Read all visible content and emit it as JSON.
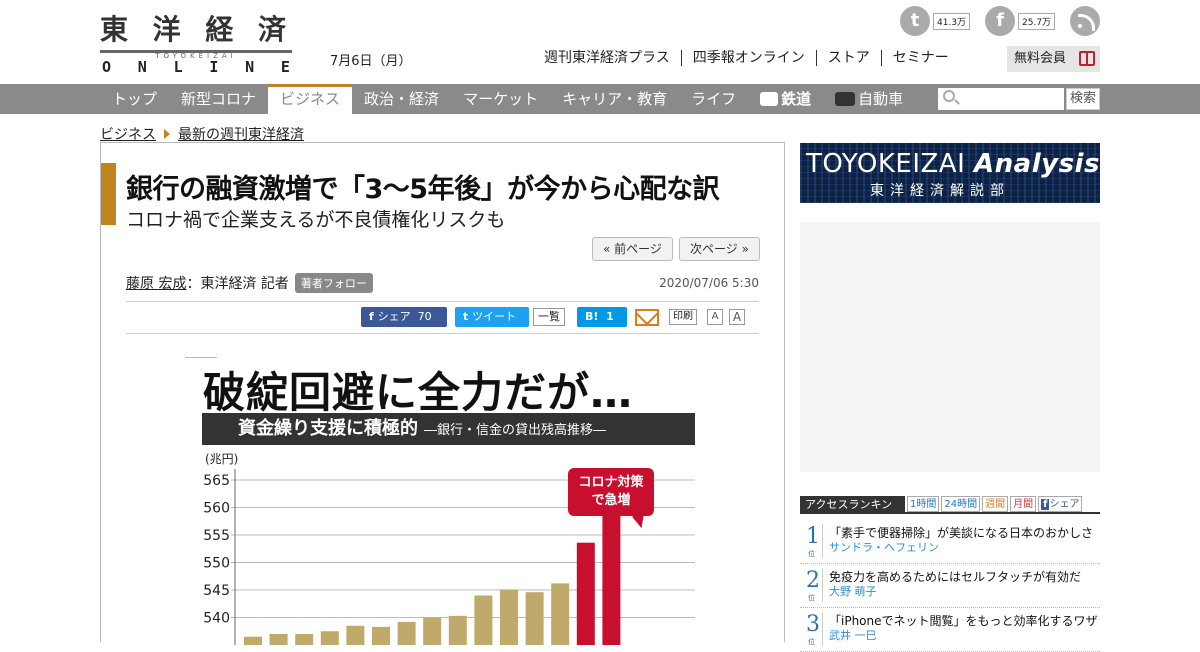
{
  "header": {
    "logo": {
      "main_chars": [
        "東",
        "洋",
        "経",
        "済"
      ],
      "sub": "TOYOKEIZAI",
      "online_chars": [
        "O",
        "N",
        "L",
        "I",
        "N",
        "E"
      ]
    },
    "date": "7月6日（月）",
    "top_links": [
      "週刊東洋経済プラス",
      "四季報オンライン",
      "ストア",
      "セミナー"
    ],
    "member_label": "無料会員",
    "twitter_count": "41.3万",
    "facebook_count": "25.7万"
  },
  "nav": {
    "items": [
      {
        "label": "トップ",
        "active": false
      },
      {
        "label": "新型コロナ",
        "active": false
      },
      {
        "label": "ビジネス",
        "active": true
      },
      {
        "label": "政治・経済",
        "active": false
      },
      {
        "label": "マーケット",
        "active": false
      },
      {
        "label": "キャリア・教育",
        "active": false
      },
      {
        "label": "ライフ",
        "active": false
      }
    ],
    "railway": "鉄道",
    "car": "自動車",
    "search_button": "検索"
  },
  "breadcrumb": {
    "section": "ビジネス",
    "sub": "最新の週刊東洋経済"
  },
  "article": {
    "title": "銀行の融資激増で「3～5年後」が今から心配な訳",
    "subtitle": "コロナ禍で企業支えるが不良債権化リスクも",
    "prev_page": "« 前ページ",
    "next_page": "次ページ »",
    "author_name": "藤原 宏成",
    "author_role": "：東洋経済 記者",
    "follow_label": "著者フォロー",
    "published": "2020/07/06 5:30",
    "share": {
      "facebook": "シェア",
      "facebook_count": "70",
      "tweet": "ツイート",
      "ichiran": "一覧",
      "hatena": "B!",
      "hatena_count": "1",
      "print": "印刷",
      "font_small": "A",
      "font_large": "A"
    }
  },
  "figure": {
    "headline": "破綻回避に全力だが…",
    "band_main": "資金繰り支援に積極的",
    "band_sub": "―銀行・信金の貸出残高推移―",
    "unit": "(兆円)",
    "callout_line1": "コロナ対策",
    "callout_line2": "で急増",
    "colors": {
      "normal": "#bfaa6b",
      "highlight": "#c8102e",
      "band": "#333333"
    }
  },
  "chart_data": {
    "type": "bar",
    "ylabel": "(兆円)",
    "ylim": [
      535,
      567
    ],
    "yticks": [
      540,
      545,
      550,
      555,
      560,
      565
    ],
    "values": [
      536.5,
      537,
      537,
      537.5,
      538.5,
      538.3,
      539.2,
      540,
      540.3,
      544,
      545.1,
      544.6,
      546.2,
      553.6,
      563.2
    ],
    "highlight_last": 2,
    "grid": true
  },
  "sidebar": {
    "analysis_brand": "TOYOKEIZAI",
    "analysis_word": "Analysis",
    "analysis_sub": "東洋経済解説部",
    "ranking_title": "アクセスランキング",
    "ranking_tabs": [
      "1時間",
      "24時間",
      "週間",
      "月間",
      "シェア"
    ],
    "ranking_items": [
      {
        "rank": "1",
        "unit": "位",
        "title": "「素手で便器掃除」が美談になる日本のおかしさ",
        "author": "サンドラ・ヘフェリン"
      },
      {
        "rank": "2",
        "unit": "位",
        "title": "免疫力を高めるためにはセルフタッチが有効だ",
        "author": "大野 萌子"
      },
      {
        "rank": "3",
        "unit": "位",
        "title": "「iPhoneでネット閲覧」をもっと効率化するワザ",
        "author": "武井 一巳"
      }
    ]
  }
}
